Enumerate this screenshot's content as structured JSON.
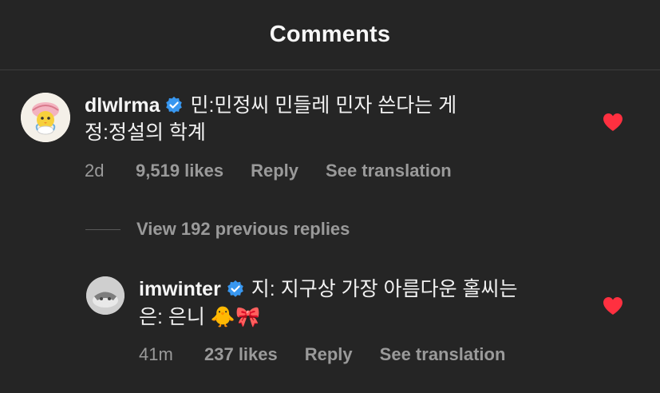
{
  "header": {
    "title": "Comments"
  },
  "comments": [
    {
      "username": "dlwlrma",
      "text_line1": "민:민정씨 민들레 민자 쓴다는 게",
      "text_line2": "정:정설의 학계",
      "time": "2d",
      "likes": "9,519 likes",
      "reply": "Reply",
      "translate": "See translation",
      "liked": true,
      "avatar_icon": "cartoon-chick-avatar"
    }
  ],
  "view_replies": "View 192 previous replies",
  "replies": [
    {
      "username": "imwinter",
      "text_line1": "지: 지구상 가장 아름다운 홀씨는",
      "text_line2": "은: 은니 🐥🎀",
      "time": "41m",
      "likes": "237 likes",
      "reply": "Reply",
      "translate": "See translation",
      "liked": true,
      "avatar_icon": "winter-photo-avatar"
    }
  ],
  "colors": {
    "background": "#252525",
    "heart": "#ff3040",
    "verified": "#3897f0",
    "muted": "#9a9a9a"
  }
}
